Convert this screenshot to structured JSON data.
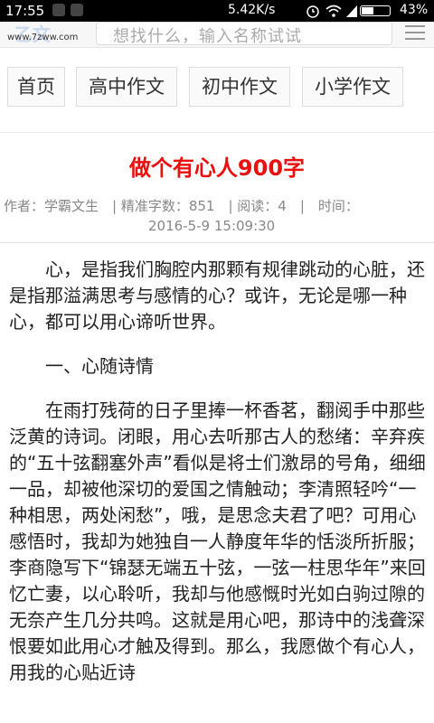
{
  "status_bar": {
    "time": "17:55",
    "speed": "5.42K/s",
    "battery": "43%",
    "battery_level": 0.43
  },
  "header": {
    "logo_url": "www.7zww.com",
    "logo_mark": "乙文",
    "search_placeholder": "想找什么，输入名称试试"
  },
  "nav": {
    "items": [
      {
        "label": "首页"
      },
      {
        "label": "高中作文"
      },
      {
        "label": "初中作文"
      },
      {
        "label": "小学作文"
      }
    ]
  },
  "article": {
    "title": "做个有心人900字",
    "meta_line": "作者：学霸文生　| 精准字数：851　| 阅读：4　|　时间：",
    "date": "2016-5-9 15:09:30",
    "paragraphs": [
      "心，是指我们胸腔内那颗有规律跳动的心脏，还是指那溢满思考与感情的心？或许，无论是哪一种心，都可以用心谛听世界。",
      "一、心随诗情",
      "在雨打残荷的日子里捧一杯香茗，翻阅手中那些泛黄的诗词。闭眼，用心去听那古人的愁绪：辛弃疾的“五十弦翻塞外声”看似是将士们激昂的号角，细细一品，却被他深切的爱国之情触动；李清照轻吟“一种相思，两处闲愁”，哦，是思念夫君了吧？可用心感悟时，我却为她独自一人静度年华的恬淡所折服；李商隐写下“锦瑟无端五十弦，一弦一柱思华年”来回忆亡妻，以心聆听，我却与他感慨时光如白驹过隙的无奈产生几分共鸣。这就是用心吧，那诗中的浅聋深恨要如此用心才触及得到。那么，我愿做个有心人，用我的心贴近诗"
    ]
  }
}
